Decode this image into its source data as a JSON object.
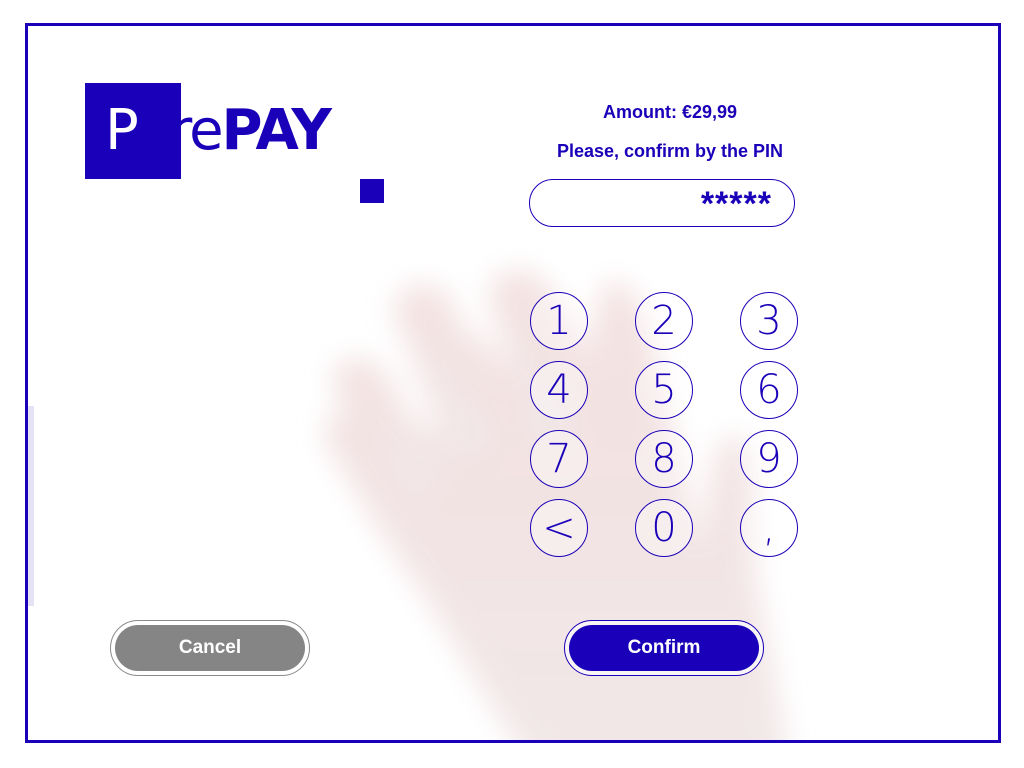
{
  "brand": {
    "first_letter": "P",
    "light_part": "ure",
    "bold_part": "PAY",
    "color": "#1a00b8"
  },
  "payment": {
    "amount_text": "Amount: €29,99",
    "prompt_text": "Please, confirm by the PIN",
    "pin_value": "*****"
  },
  "keypad": {
    "keys": [
      "1",
      "2",
      "3",
      "4",
      "5",
      "6",
      "7",
      "8",
      "9",
      "<",
      "0",
      ","
    ]
  },
  "buttons": {
    "cancel_label": "Cancel",
    "confirm_label": "Confirm"
  },
  "colors": {
    "accent": "#1a00b8",
    "cancel": "#858585",
    "background": "#ffffff"
  }
}
